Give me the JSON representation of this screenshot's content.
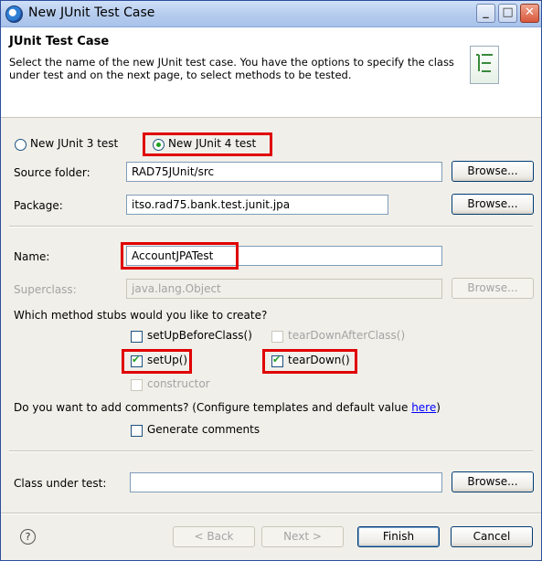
{
  "window": {
    "title": "New JUnit Test Case"
  },
  "header": {
    "title": "JUnit Test Case",
    "description": "Select the name of the new JUnit test case. You have the options to specify the class under test and on the next page, to select methods to be tested."
  },
  "version": {
    "junit3_label": "New JUnit 3 test",
    "junit4_label": "New JUnit 4 test",
    "selected": "junit4"
  },
  "source_folder": {
    "label": "Source folder:",
    "value": "RAD75JUnit/src",
    "browse": "Browse..."
  },
  "package": {
    "label": "Package:",
    "value": "itso.rad75.bank.test.junit.jpa",
    "browse": "Browse..."
  },
  "name": {
    "label": "Name:",
    "value": "AccountJPATest"
  },
  "superclass": {
    "label": "Superclass:",
    "value": "java.lang.Object",
    "browse": "Browse..."
  },
  "stubs": {
    "question": "Which method stubs would you like to create?",
    "setUpBeforeClass": {
      "label": "setUpBeforeClass()",
      "checked": false
    },
    "tearDownAfterClass": {
      "label": "tearDownAfterClass()",
      "checked": false,
      "enabled": false
    },
    "setUp": {
      "label": "setUp()",
      "checked": true
    },
    "tearDown": {
      "label": "tearDown()",
      "checked": true
    },
    "constructor": {
      "label": "constructor",
      "checked": false,
      "enabled": false
    }
  },
  "comments": {
    "question": "Do you want to add comments? (Configure templates and default value ",
    "link": "here",
    "question_end": ")",
    "generate": {
      "label": "Generate comments",
      "checked": false
    }
  },
  "class_under_test": {
    "label": "Class under test:",
    "value": "",
    "browse": "Browse..."
  },
  "footer": {
    "help": "?",
    "back": "< Back",
    "next": "Next >",
    "finish": "Finish",
    "cancel": "Cancel"
  },
  "colors": {
    "highlight": "#e00000",
    "titlebar": "#b7cdee",
    "dialog_bg": "#f0efe9"
  }
}
